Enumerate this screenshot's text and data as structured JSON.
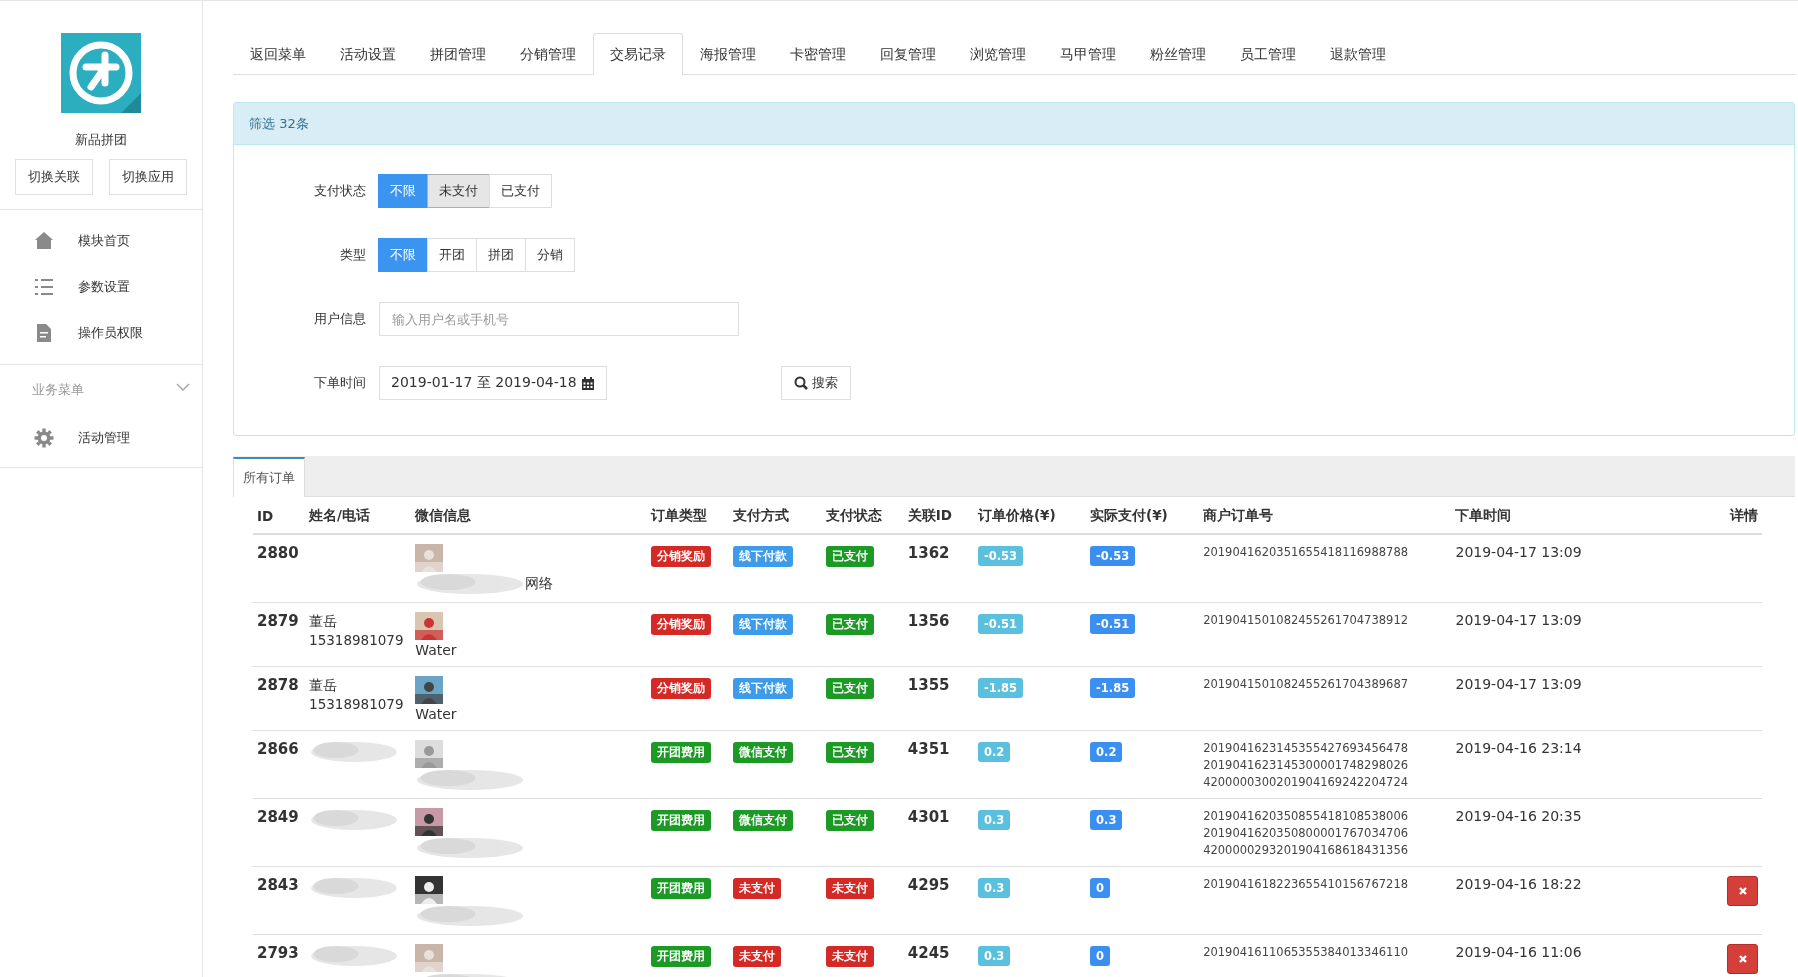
{
  "sidebar": {
    "app_name": "新品拼团",
    "buttons": [
      "切换关联",
      "切换应用"
    ],
    "items": [
      {
        "label": "模块首页",
        "kind": "home"
      },
      {
        "label": "参数设置",
        "kind": "list"
      },
      {
        "label": "操作员权限",
        "kind": "document"
      }
    ],
    "section": {
      "title": "业务菜单",
      "expanded": true,
      "items": [
        {
          "label": "活动管理",
          "kind": "gear"
        }
      ]
    }
  },
  "tabs": [
    {
      "label": "返回菜单",
      "selected": false
    },
    {
      "label": "活动设置",
      "selected": false
    },
    {
      "label": "拼团管理",
      "selected": false
    },
    {
      "label": "分销管理",
      "selected": false
    },
    {
      "label": "交易记录",
      "selected": true
    },
    {
      "label": "海报管理",
      "selected": false
    },
    {
      "label": "卡密管理",
      "selected": false
    },
    {
      "label": "回复管理",
      "selected": false
    },
    {
      "label": "浏览管理",
      "selected": false
    },
    {
      "label": "马甲管理",
      "selected": false
    },
    {
      "label": "粉丝管理",
      "selected": false
    },
    {
      "label": "员工管理",
      "selected": false
    },
    {
      "label": "退款管理",
      "selected": false
    }
  ],
  "filter": {
    "title": "筛选 32条",
    "pay_status": {
      "label": "支付状态",
      "options": [
        {
          "label": "不限",
          "selected": true,
          "hovered": false
        },
        {
          "label": "未支付",
          "selected": false,
          "hovered": true
        },
        {
          "label": "已支付",
          "selected": false,
          "hovered": false
        }
      ]
    },
    "type": {
      "label": "类型",
      "options": [
        {
          "label": "不限",
          "selected": true,
          "hovered": false
        },
        {
          "label": "开团",
          "selected": false,
          "hovered": false
        },
        {
          "label": "拼团",
          "selected": false,
          "hovered": false
        },
        {
          "label": "分销",
          "selected": false,
          "hovered": false
        }
      ]
    },
    "user": {
      "label": "用户信息",
      "placeholder": "输入用户名或手机号"
    },
    "date": {
      "label": "下单时间",
      "value": "2019-01-17 至 2019-04-18"
    },
    "search_button": "搜索"
  },
  "orders": {
    "tabs": [
      {
        "label": "所有订单"
      }
    ],
    "columns": [
      "ID",
      "姓名/电话",
      "微信信息",
      "订单类型",
      "支付方式",
      "支付状态",
      "关联ID",
      "订单价格(¥)",
      "实际支付(¥)",
      "商户订单号",
      "下单时间",
      "详情"
    ],
    "rows": [
      {
        "id": "2880",
        "redacted": false,
        "wechat": "网络",
        "wechat_redacted": true,
        "order_type": {
          "text": "分销奖励",
          "color": "#d42a26"
        },
        "pay_method": {
          "text": "线下付款",
          "color": "#3d9be9"
        },
        "pay_status": {
          "text": "已支付",
          "color": "#1d9a26"
        },
        "related_id": "1362",
        "price": "-0.53",
        "paid": "-0.53",
        "merchant_nos": [
          "2019041620351655418116988788"
        ],
        "time": "2019-04-17 13:09",
        "deletable": false
      },
      {
        "id": "2879",
        "name": "董岳",
        "phone": "15318981079",
        "redacted": false,
        "wechat": "Water",
        "wechat_redacted": false,
        "order_type": {
          "text": "分销奖励",
          "color": "#d42a26"
        },
        "pay_method": {
          "text": "线下付款",
          "color": "#3d9be9"
        },
        "pay_status": {
          "text": "已支付",
          "color": "#1d9a26"
        },
        "related_id": "1356",
        "price": "-0.51",
        "paid": "-0.51",
        "merchant_nos": [
          "2019041501082455261704738912"
        ],
        "time": "2019-04-17 13:09",
        "deletable": false
      },
      {
        "id": "2878",
        "name": "董岳",
        "phone": "15318981079",
        "redacted": false,
        "wechat": "Water",
        "wechat_redacted": false,
        "order_type": {
          "text": "分销奖励",
          "color": "#d42a26"
        },
        "pay_method": {
          "text": "线下付款",
          "color": "#3d9be9"
        },
        "pay_status": {
          "text": "已支付",
          "color": "#1d9a26"
        },
        "related_id": "1355",
        "price": "-1.85",
        "paid": "-1.85",
        "merchant_nos": [
          "2019041501082455261704389687"
        ],
        "time": "2019-04-17 13:09",
        "deletable": false
      },
      {
        "id": "2866",
        "redacted": true,
        "wechat_redacted": true,
        "order_type": {
          "text": "开团费用",
          "color": "#1d9a26"
        },
        "pay_method": {
          "text": "微信支付",
          "color": "#1d9a26"
        },
        "pay_status": {
          "text": "已支付",
          "color": "#1d9a26"
        },
        "related_id": "4351",
        "price": "0.2",
        "paid": "0.2",
        "merchant_nos": [
          "2019041623145355427693456478",
          "2019041623145300001748298026",
          "4200000300201904169242204724"
        ],
        "time": "2019-04-16 23:14",
        "deletable": false
      },
      {
        "id": "2849",
        "redacted": true,
        "wechat_redacted": true,
        "order_type": {
          "text": "开团费用",
          "color": "#1d9a26"
        },
        "pay_method": {
          "text": "微信支付",
          "color": "#1d9a26"
        },
        "pay_status": {
          "text": "已支付",
          "color": "#1d9a26"
        },
        "related_id": "4301",
        "price": "0.3",
        "paid": "0.3",
        "merchant_nos": [
          "2019041620350855418108538006",
          "2019041620350800001767034706",
          "4200000293201904168618431356"
        ],
        "time": "2019-04-16 20:35",
        "deletable": false
      },
      {
        "id": "2843",
        "redacted": true,
        "wechat_redacted": true,
        "order_type": {
          "text": "开团费用",
          "color": "#1d9a26"
        },
        "pay_method": {
          "text": "未支付",
          "color": "#d42a26"
        },
        "pay_status": {
          "text": "未支付",
          "color": "#d42a26"
        },
        "related_id": "4295",
        "price": "0.3",
        "paid": "0",
        "merchant_nos": [
          "2019041618223655410156767218"
        ],
        "time": "2019-04-16 18:22",
        "deletable": true
      },
      {
        "id": "2793",
        "redacted": true,
        "wechat_redacted": true,
        "order_type": {
          "text": "开团费用",
          "color": "#1d9a26"
        },
        "pay_method": {
          "text": "未支付",
          "color": "#d42a26"
        },
        "pay_status": {
          "text": "未支付",
          "color": "#d42a26"
        },
        "related_id": "4245",
        "price": "0.3",
        "paid": "0",
        "merchant_nos": [
          "2019041611065355384013346110"
        ],
        "time": "2019-04-16 11:06",
        "deletable": true
      }
    ]
  }
}
